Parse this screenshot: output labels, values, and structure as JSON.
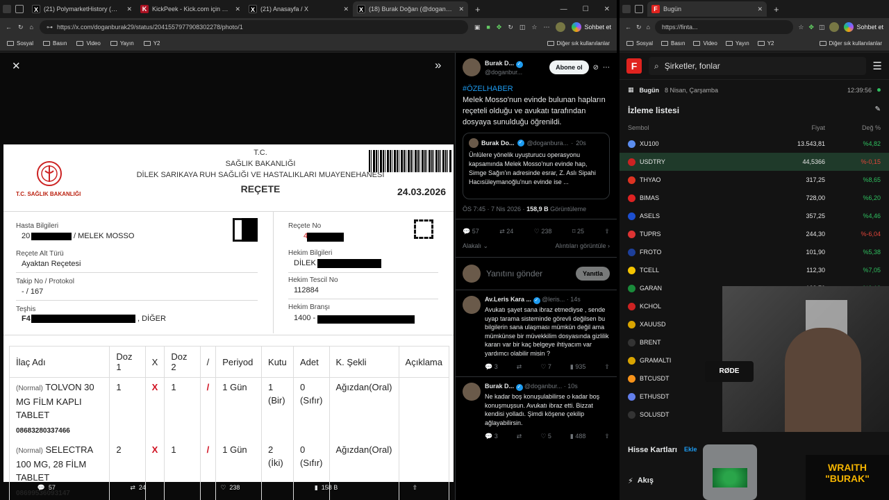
{
  "left_browser": {
    "tabs": [
      {
        "title": "(21) PolymarketHistory (@Polymar",
        "icon": "x-icon"
      },
      {
        "title": "KickPeek - Kick.com için Gerçek Za",
        "icon": "kickpeek-icon"
      },
      {
        "title": "(21) Anasayfa / X",
        "icon": "x-icon"
      },
      {
        "title": "(18) Burak Doğan (@doganburak2",
        "icon": "x-icon"
      }
    ],
    "url": "https://x.com/doganburak29/status/2041557977908302278/photo/1",
    "chat_label": "Sohbet et",
    "bookmarks": [
      "Sosyal",
      "Basın",
      "Video",
      "Yayın",
      "Y2"
    ],
    "other_bookmarks": "Diğer sık kullanılanlar"
  },
  "prescription": {
    "org1": "T.C.",
    "org2": "SAĞLIK BAKANLIĞI",
    "org3": "DİLEK SARIKAYA RUH SAĞLIĞI VE HASTALIKLARI MUAYENEHANESİ",
    "title": "REÇETE",
    "date": "24.03.2026",
    "logo_text": "T.C. SAĞLIK BAKANLIĞI",
    "patient_label": "Hasta Bilgileri",
    "patient_prefix": "20",
    "patient_name": "/ MELEK MOSSO",
    "subtype_label": "Reçete Alt Türü",
    "subtype": "Ayaktan Reçetesi",
    "protocol_label": "Takip No / Protokol",
    "protocol": "- / 167",
    "diag_label": "Teşhis",
    "diag_prefix": "F4",
    "diag_suffix": ", DİĞER",
    "rx_no_label": "Reçete No",
    "rx_no_prefix": "4",
    "doctor_label": "Hekim Bilgileri",
    "doctor": "DİLEK",
    "reg_label": "Hekim Tescil No",
    "reg": "112884",
    "branch_label": "Hekim Branşı",
    "branch": "1400 -",
    "headers": [
      "İlaç Adı",
      "Doz 1",
      "X",
      "Doz 2",
      "/",
      "Periyod",
      "Kutu",
      "Adet",
      "K. Şekli",
      "Açıklama"
    ],
    "drugs": [
      {
        "type": "(Normal)",
        "name": "TOLVON 30 MG FİLM KAPLI TABLET",
        "barcode": "08683280337466",
        "doz1": "1",
        "x": "X",
        "doz2": "1",
        "slash": "/",
        "period": "1 Gün",
        "kutu": "1 (Bir)",
        "adet": "0 (Sıfır)",
        "sekil": "Ağızdan(Oral)"
      },
      {
        "type": "(Normal)",
        "name": "SELECTRA 100 MG, 28 FİLM TABLET",
        "barcode": "08699536093147",
        "doz1": "2",
        "x": "X",
        "doz2": "1",
        "slash": "/",
        "period": "1 Gün",
        "kutu": "2 (İki)",
        "adet": "0 (Sıfır)",
        "sekil": "Ağızdan(Oral)"
      }
    ]
  },
  "viewer_bar": {
    "replies": "57",
    "reposts": "24",
    "likes": "238",
    "views": "158 B"
  },
  "tweet": {
    "author": "Burak D...",
    "handle": "@doganbur...",
    "follow": "Abone ol",
    "hashtag": "#ÖZELHABER",
    "text": "Melek Mosso'nun evinde bulunan hapların reçeteli olduğu ve avukatı tarafından dosyaya sunulduğu öğrenildi.",
    "quote_author": "Burak Do...",
    "quote_handle": "@doganbura...",
    "quote_time": "20s",
    "quote_text": "Ünlülere yönelik uyuşturucu operasyonu kapsamında Melek Mosso'nun evinde hap, Simge Sağın'ın adresinde esrar, Z. Aslı Sipahi Hacısüleymanoğlu'nun evinde ise ...",
    "time": "ÖS 7:45 · 7 Nis 2026 ·",
    "views_num": "158,9 B",
    "views_label": "Görüntüleme",
    "stats": {
      "replies": "57",
      "reposts": "24",
      "likes": "238",
      "bookmarks": "25"
    },
    "relevant": "Alakalı",
    "quotes": "Alıntıları görüntüle",
    "reply_placeholder": "Yanıtını gönder",
    "reply_btn": "Yanıtla"
  },
  "replies": [
    {
      "author": "Av.Leris Kara ...",
      "handle": "@leris...",
      "time": "14s",
      "text": "Avukatı şayet sana ibraz etmediyse , sende uyap tarama sisteminde görevli değilsen bu bilgilerin sana ulaşması mümkün değil ama mümkünse bir müvekkilim dosyasında gizlilik kararı var bir kaç belgeye ihtiyacım var yardımcı olabilir misin ?",
      "r": "3",
      "l": "7",
      "v": "935"
    },
    {
      "author": "Burak D...",
      "handle": "@doganbur...",
      "time": "10s",
      "text": "Ne kadar boş konuşulabilirse o kadar boş konuşmuşsun. Avukatı ibraz etti. Bizzat kendisi yolladı. Şimdi köşene çekilip ağlayabilirsin.",
      "r": "3",
      "l": "5",
      "v": "488"
    }
  ],
  "right_browser": {
    "tab_title": "Bugün",
    "url": "https://finta...",
    "chat_label": "Sohbet et",
    "bookmarks": [
      "Sosyal",
      "Basın",
      "Video",
      "Yayın",
      "Y2"
    ],
    "other_bookmarks": "Diğer sık kullanılanlar",
    "search_placeholder": "Şirketler, fonlar",
    "today_label": "Bugün",
    "today_date": "8 Nisan, Çarşamba",
    "clock": "12:39:56",
    "watchlist_title": "İzleme listesi",
    "col_symbol": "Sembol",
    "col_price": "Fiyat",
    "col_change": "Değ %",
    "rows": [
      {
        "sym": "XU100",
        "price": "13.543,81",
        "chg": "%4,82",
        "dir": "pos",
        "color": "#5b8def"
      },
      {
        "sym": "USDTRY",
        "price": "44,5366",
        "chg": "%-0,15",
        "dir": "neg",
        "color": "#c22"
      },
      {
        "sym": "THYAO",
        "price": "317,25",
        "chg": "%8,65",
        "dir": "pos",
        "color": "#d32"
      },
      {
        "sym": "BIMAS",
        "price": "728,00",
        "chg": "%6,20",
        "dir": "pos",
        "color": "#d22"
      },
      {
        "sym": "ASELS",
        "price": "357,25",
        "chg": "%4,46",
        "dir": "pos",
        "color": "#1d4fd0"
      },
      {
        "sym": "TUPRS",
        "price": "244,30",
        "chg": "%-6,04",
        "dir": "neg",
        "color": "#d33"
      },
      {
        "sym": "FROTO",
        "price": "101,90",
        "chg": "%5,38",
        "dir": "pos",
        "color": "#1d3f9a"
      },
      {
        "sym": "TCELL",
        "price": "112,30",
        "chg": "%7,05",
        "dir": "pos",
        "color": "#f5c400"
      },
      {
        "sym": "GARAN",
        "price": "138,70",
        "chg": "%9,13",
        "dir": "pos",
        "color": "#1a8a3a"
      },
      {
        "sym": "KCHOL",
        "price": "",
        "chg": "",
        "dir": "pos",
        "color": "#c22"
      },
      {
        "sym": "XAUUSD",
        "price": "",
        "chg": "",
        "dir": "pos",
        "color": "#d9a400"
      },
      {
        "sym": "BRENT",
        "price": "",
        "chg": "",
        "dir": "pos",
        "color": "#333"
      },
      {
        "sym": "GRAMALTI",
        "price": "",
        "chg": "",
        "dir": "pos",
        "color": "#d9a400"
      },
      {
        "sym": "BTCUSDT",
        "price": "",
        "chg": "",
        "dir": "pos",
        "color": "#f7931a"
      },
      {
        "sym": "ETHUSDT",
        "price": "",
        "chg": "",
        "dir": "pos",
        "color": "#627eea"
      },
      {
        "sym": "SOLUSDT",
        "price": "",
        "chg": "",
        "dir": "pos",
        "color": "#333"
      }
    ],
    "cards_title": "Hisse Kartları",
    "cards_add": "Ekle",
    "flow_title": "Akış"
  },
  "overlay": {
    "brand1": "WRAITH",
    "brand2": "\"BURAK\"",
    "mic": "RØDE"
  }
}
